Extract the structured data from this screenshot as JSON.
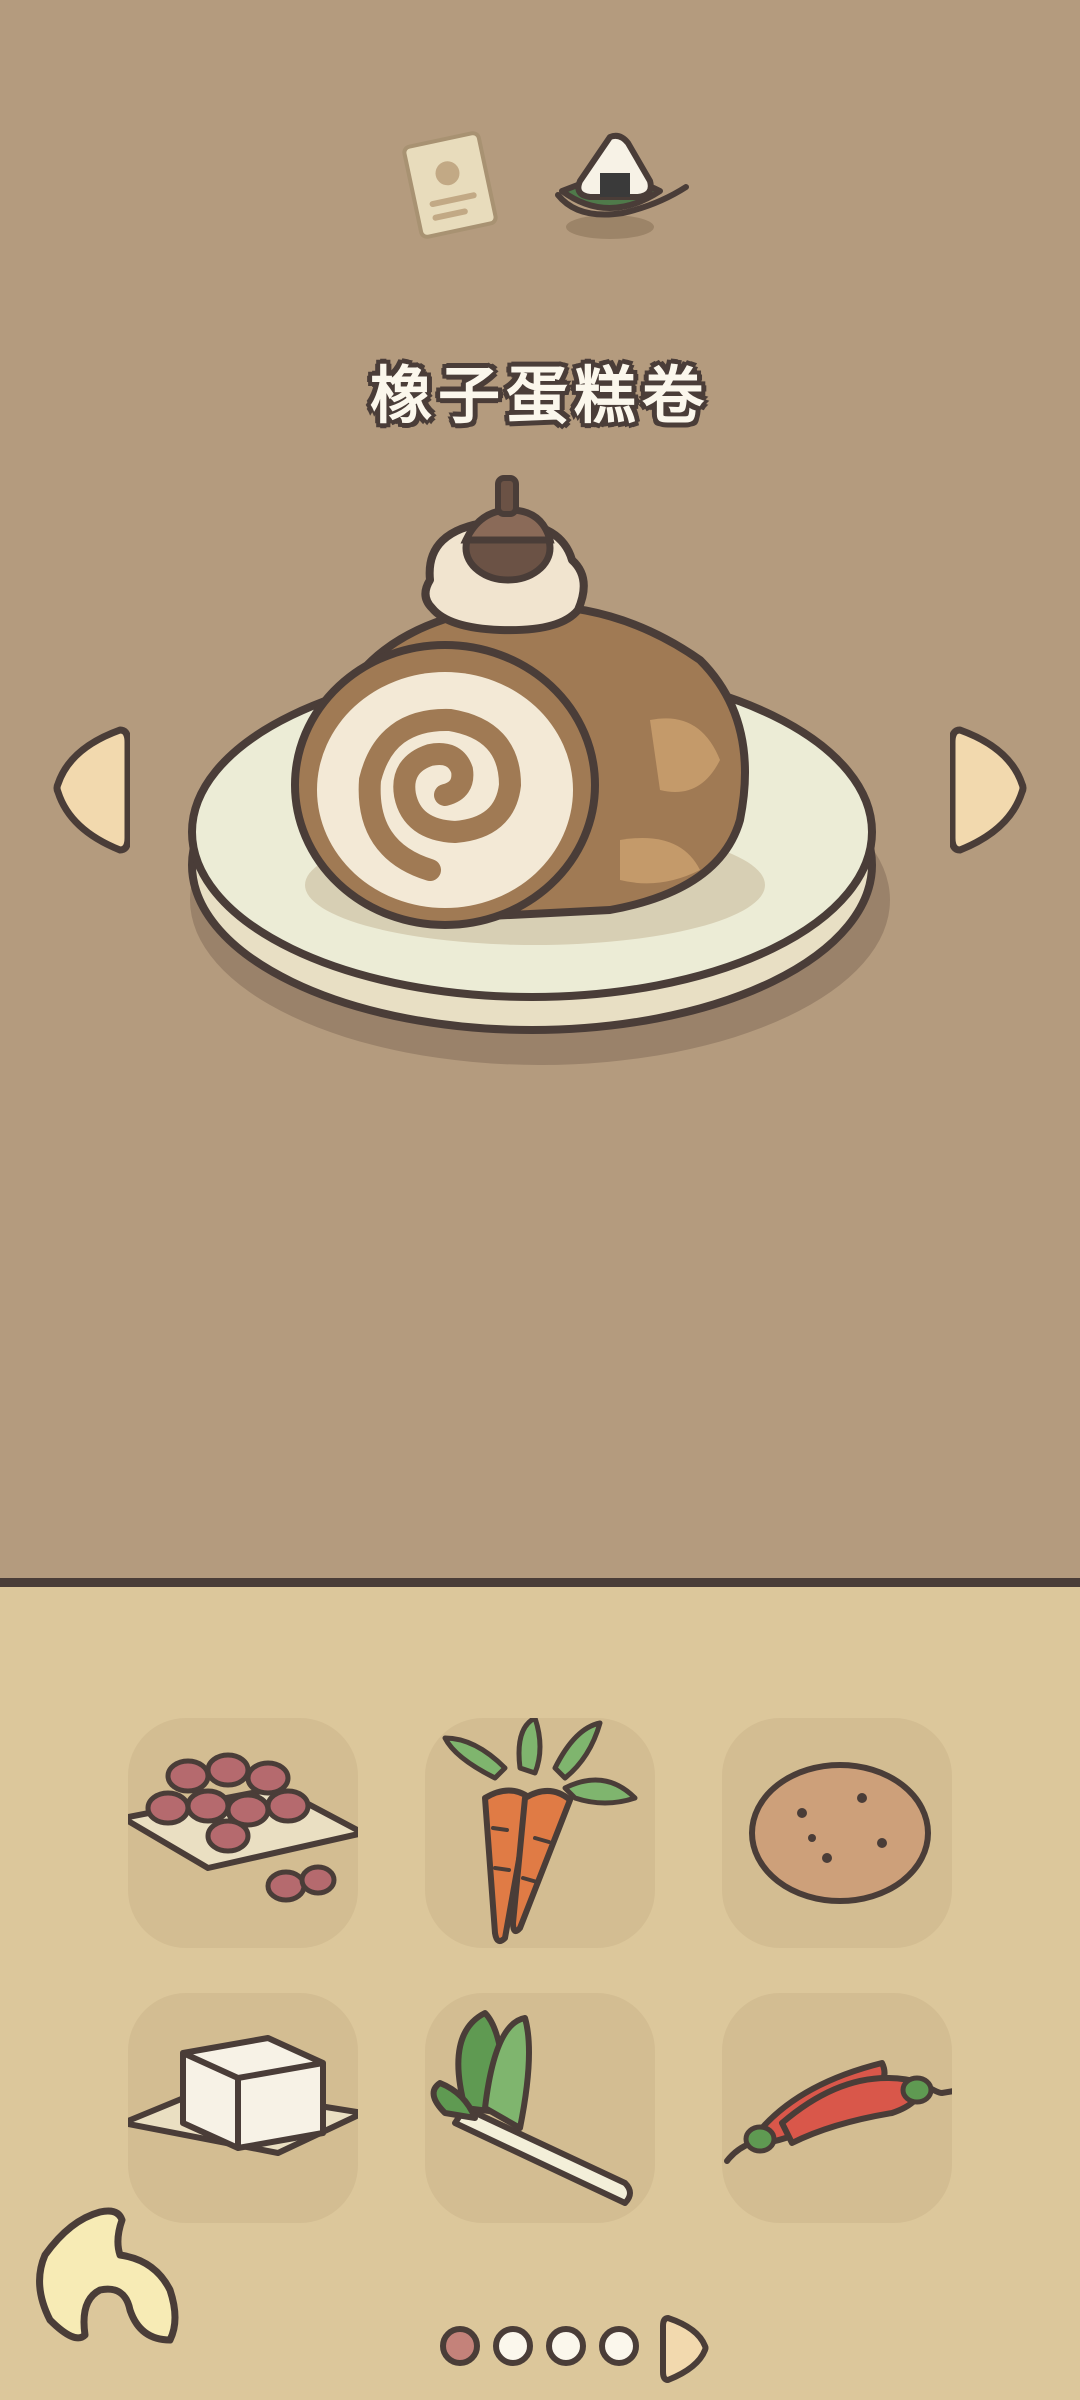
{
  "dish": {
    "name": "橡子蛋糕卷",
    "image_icon": "acorn-cake-roll"
  },
  "tabs": [
    {
      "icon": "recipe-card-icon",
      "active": false
    },
    {
      "icon": "onigiri-icon",
      "active": true
    }
  ],
  "ingredients": [
    {
      "icon": "red-beans-icon"
    },
    {
      "icon": "carrot-icon"
    },
    {
      "icon": "potato-icon"
    },
    {
      "icon": "tofu-icon"
    },
    {
      "icon": "green-onion-icon"
    },
    {
      "icon": "chili-pepper-icon"
    }
  ],
  "pagination": {
    "total_pages": 4,
    "current_page": 1
  },
  "colors": {
    "background_top": "#b49b7e",
    "background_bottom": "#dcc79b",
    "slot": "#d3bd92",
    "outline": "#4a3d38",
    "page_dot_active": "#c4827a",
    "arrow_fill": "#f2d9ae"
  }
}
